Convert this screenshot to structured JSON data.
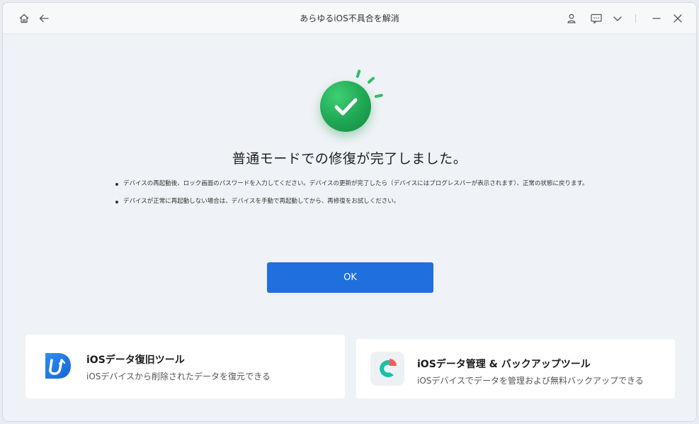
{
  "window": {
    "title": "あらゆるiOS不具合を解消"
  },
  "toolbar": {
    "home_icon": "home-icon",
    "back_icon": "back-arrow-icon",
    "account_icon": "user-icon",
    "feedback_icon": "message-icon",
    "menu_icon": "chevron-down-icon",
    "minimize_icon": "minimize-icon",
    "close_icon": "close-icon"
  },
  "result": {
    "status_icon": "check-circle-icon",
    "heading": "普通モードでの修復が完了しました。",
    "notes": [
      "デバイスの再起動後、ロック画面のパスワードを入力してください。デバイスの更新が完了したら（デバイスにはプログレスバーが表示されます）、正常の状態に戻ります。",
      "デバイスが正常に再起動しない場合は、デバイスを手動で再起動してから、再修復をお試しください。"
    ],
    "ok_label": "OK"
  },
  "promos": [
    {
      "title": "iOSデータ復旧ツール",
      "subtitle": "iOSデバイスから削除されたデータを復元できる",
      "icon": "data-recovery-app-icon"
    },
    {
      "title": "iOSデータ管理 & バックアップツール",
      "subtitle": "iOSデバイスでデータを管理および無料バックアップできる",
      "icon": "data-manager-app-icon"
    }
  ],
  "colors": {
    "accent": "#1f6fde",
    "success": "#1ea653",
    "background": "#eff2f6"
  }
}
